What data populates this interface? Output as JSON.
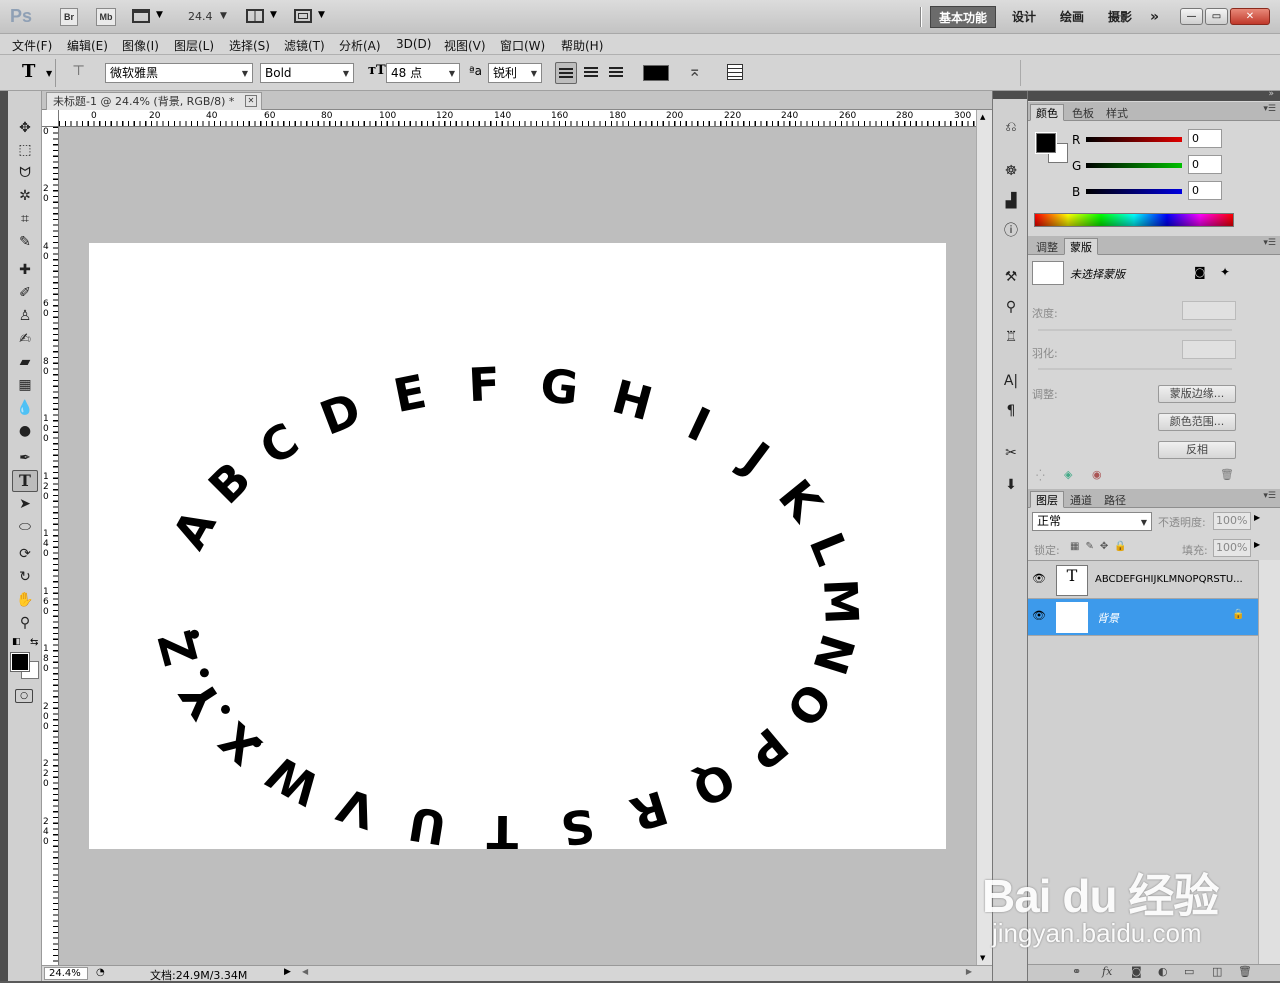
{
  "app": {
    "logo": "Ps",
    "bridge": "Br",
    "minibridge": "Mb",
    "zoom_value": "24.4"
  },
  "workspace": {
    "items": [
      "基本功能",
      "设计",
      "绘画",
      "摄影"
    ],
    "more": "»"
  },
  "window_controls": {
    "minimize": "—",
    "restore": "▭",
    "close": "✕"
  },
  "menu": [
    "文件(F)",
    "编辑(E)",
    "图像(I)",
    "图层(L)",
    "选择(S)",
    "滤镜(T)",
    "分析(A)",
    "3D(D)",
    "视图(V)",
    "窗口(W)",
    "帮助(H)"
  ],
  "options": {
    "tool_glyph": "T",
    "font_family": "微软雅黑",
    "font_style": "Bold",
    "font_size": "48 点",
    "aa_label": "ªa",
    "antialias": "锐利",
    "text_color": "#000000"
  },
  "document": {
    "tab_title": "未标题-1 @ 24.4% (背景, RGB/8) *",
    "close": "✕"
  },
  "ruler": {
    "top": [
      "0",
      "20",
      "40",
      "60",
      "80",
      "100",
      "120",
      "140",
      "160",
      "180",
      "200",
      "220",
      "240",
      "260",
      "280",
      "300"
    ],
    "left": [
      "0",
      "2 0",
      "4 0",
      "6 0",
      "8 0",
      "1 0 0",
      "1 2 0",
      "1 4 0",
      "1 6 0",
      "1 8 0",
      "2 0 0",
      "2 2 0",
      "2 4 0"
    ]
  },
  "canvas": {
    "letters": [
      "A",
      "B",
      "C",
      "D",
      "E",
      "F",
      "G",
      "H",
      "I",
      "J",
      "K",
      "L",
      "M",
      "N",
      "O",
      "P",
      "Q",
      "R",
      "S",
      "T",
      "U",
      "V",
      "W",
      "X",
      "Y",
      "Z"
    ],
    "dots": [
      "•",
      "•",
      "•",
      "•"
    ]
  },
  "status": {
    "zoom": "24.4%",
    "doc_info": "文档:24.9M/3.34M"
  },
  "color_panel": {
    "tabs": [
      "颜色",
      "色板",
      "样式"
    ],
    "channels": [
      {
        "label": "R",
        "value": "0",
        "color": "#e00000"
      },
      {
        "label": "G",
        "value": "0",
        "color": "#00c000"
      },
      {
        "label": "B",
        "value": "0",
        "color": "#0000e0"
      }
    ],
    "fg": "#000000",
    "bg": "#ffffff"
  },
  "mask_panel": {
    "tabs": [
      "调整",
      "蒙版"
    ],
    "title": "未选择蒙版",
    "density": "浓度:",
    "feather": "羽化:",
    "adjust": "调整:",
    "buttons": [
      "蒙版边缘...",
      "颜色范围...",
      "反相"
    ]
  },
  "layers_panel": {
    "tabs": [
      "图层",
      "通道",
      "路径"
    ],
    "blend": "正常",
    "opacity_label": "不透明度:",
    "opacity": "100%",
    "lock_label": "锁定:",
    "fill_label": "填充:",
    "fill": "100%",
    "layers": [
      {
        "name": "ABCDEFGHIJKLMNOPQRSTU...",
        "thumb": "T",
        "selected": false
      },
      {
        "name": "背景",
        "thumb": "",
        "selected": true
      }
    ],
    "selection_color": "#3d9aeb"
  },
  "watermark": {
    "brand": "Bai du 经验",
    "url": "jingyan.baidu.com"
  }
}
